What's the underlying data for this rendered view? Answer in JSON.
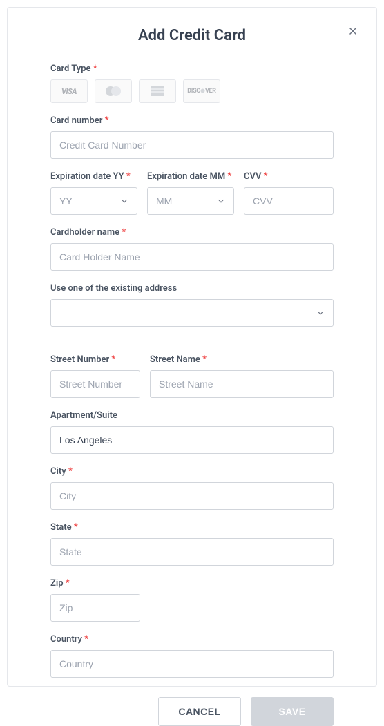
{
  "title": "Add Credit Card",
  "labels": {
    "cardType": "Card Type",
    "cardNumber": "Card number",
    "expYY": "Expiration date YY",
    "expMM": "Expiration date MM",
    "cvv": "CVV",
    "cardholder": "Cardholder name",
    "existingAddress": "Use one of the existing address",
    "streetNumber": "Street Number",
    "streetName": "Street Name",
    "apartment": "Apartment/Suite",
    "city": "City",
    "state": "State",
    "zip": "Zip",
    "country": "Country"
  },
  "placeholders": {
    "cardNumber": "Credit Card Number",
    "yy": "YY",
    "mm": "MM",
    "cvv": "CVV",
    "cardholder": "Card Holder Name",
    "streetNumber": "Street Number",
    "streetName": "Street Name",
    "city": "City",
    "state": "State",
    "zip": "Zip",
    "country": "Country"
  },
  "values": {
    "apartment": "Los Angeles"
  },
  "cardTypes": [
    "visa",
    "mastercard",
    "amex",
    "discover"
  ],
  "buttons": {
    "cancel": "CANCEL",
    "save": "SAVE"
  },
  "required": {
    "cardType": true,
    "cardNumber": true,
    "expYY": true,
    "expMM": true,
    "cvv": true,
    "cardholder": true,
    "streetNumber": true,
    "streetName": true,
    "city": true,
    "state": true,
    "zip": true,
    "country": true
  }
}
